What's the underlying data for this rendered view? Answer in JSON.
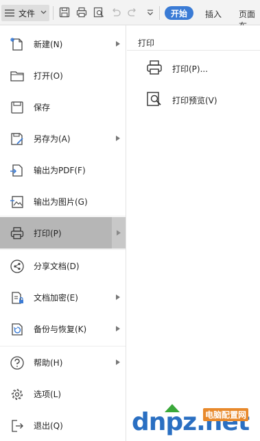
{
  "toolbar": {
    "file_label": "文件",
    "start_tab": "开始",
    "insert_tab": "插入",
    "page_tab": "页面布"
  },
  "menu": {
    "items": [
      {
        "label": "新建(N)",
        "icon": "new-doc-icon",
        "has_submenu": true
      },
      {
        "label": "打开(O)",
        "icon": "folder-icon",
        "has_submenu": false
      },
      {
        "label": "保存",
        "icon": "save-icon",
        "has_submenu": false
      },
      {
        "label": "另存为(A)",
        "icon": "save-as-icon",
        "has_submenu": true
      },
      {
        "label": "输出为PDF(F)",
        "icon": "export-pdf-icon",
        "has_submenu": false
      },
      {
        "label": "输出为图片(G)",
        "icon": "export-image-icon",
        "has_submenu": false
      },
      {
        "label": "打印(P)",
        "icon": "printer-icon",
        "has_submenu": true,
        "active": true
      },
      {
        "label": "分享文档(D)",
        "icon": "share-icon",
        "has_submenu": false
      },
      {
        "label": "文档加密(E)",
        "icon": "encrypt-icon",
        "has_submenu": true
      },
      {
        "label": "备份与恢复(K)",
        "icon": "backup-icon",
        "has_submenu": true
      },
      {
        "label": "帮助(H)",
        "icon": "help-icon",
        "has_submenu": true
      },
      {
        "label": "选项(L)",
        "icon": "gear-icon",
        "has_submenu": false
      },
      {
        "label": "退出(Q)",
        "icon": "exit-icon",
        "has_submenu": false
      }
    ]
  },
  "panel": {
    "title": "打印",
    "items": [
      {
        "label": "打印(P)...",
        "icon": "printer-icon"
      },
      {
        "label": "打印预览(V)",
        "icon": "print-preview-icon"
      }
    ]
  },
  "watermark": {
    "brand": "dnpz.net",
    "site": "电脑配置网"
  },
  "colors": {
    "accent": "#3a7bd5",
    "active_item": "#b6b6b6"
  }
}
